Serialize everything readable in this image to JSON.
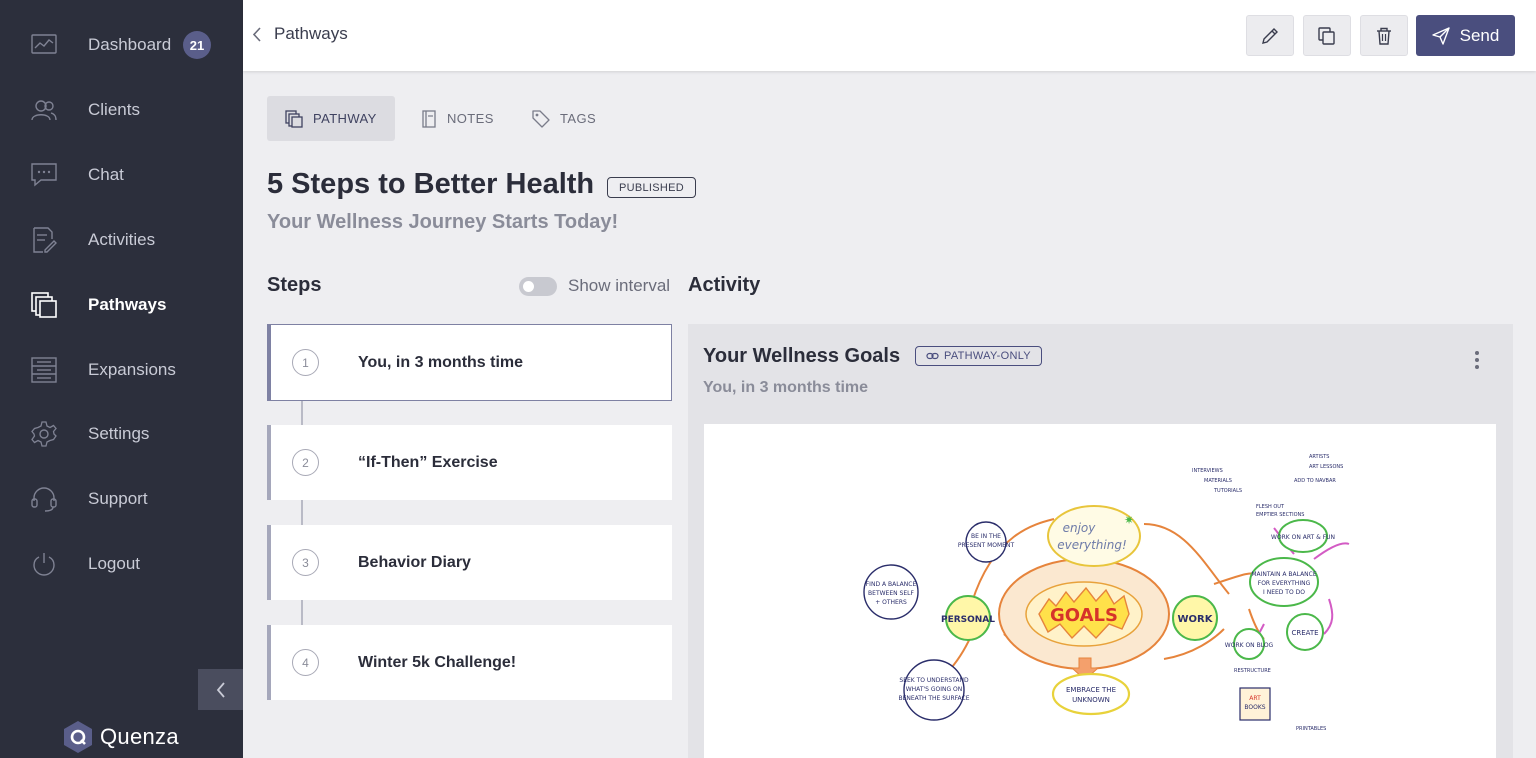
{
  "sidebar": {
    "items": [
      {
        "label": "Dashboard",
        "icon": "chart-icon",
        "badge": "21"
      },
      {
        "label": "Clients",
        "icon": "users-icon"
      },
      {
        "label": "Chat",
        "icon": "chat-icon"
      },
      {
        "label": "Activities",
        "icon": "edit-document-icon"
      },
      {
        "label": "Pathways",
        "icon": "copy-stack-icon",
        "active": true
      },
      {
        "label": "Expansions",
        "icon": "layers-icon"
      },
      {
        "label": "Settings",
        "icon": "gear-icon"
      },
      {
        "label": "Support",
        "icon": "headset-icon"
      },
      {
        "label": "Logout",
        "icon": "power-icon"
      }
    ],
    "logo_text": "Quenza"
  },
  "header": {
    "back_label": "Pathways",
    "send_label": "Send"
  },
  "tabs": [
    {
      "label": "PATHWAY",
      "icon": "copy-stack-icon",
      "active": true
    },
    {
      "label": "NOTES",
      "icon": "notebook-icon"
    },
    {
      "label": "TAGS",
      "icon": "tag-icon"
    }
  ],
  "pathway": {
    "title": "5 Steps to Better Health",
    "status": "PUBLISHED",
    "subtitle": "Your Wellness Journey Starts Today!"
  },
  "steps_section": {
    "heading": "Steps",
    "toggle_label": "Show interval",
    "toggle_on": false,
    "items": [
      {
        "number": "1",
        "title": "You, in 3 months time"
      },
      {
        "number": "2",
        "title": "“If-Then” Exercise"
      },
      {
        "number": "3",
        "title": "Behavior Diary"
      },
      {
        "number": "4",
        "title": "Winter 5k Challenge!"
      }
    ]
  },
  "activity": {
    "heading": "Activity",
    "title": "Your Wellness Goals",
    "badge": "PATHWAY-ONLY",
    "subtitle": "You, in 3 months time",
    "mindmap": {
      "center": "GOALS",
      "nodes": [
        "enjoy everything!",
        "PERSONAL",
        "WORK",
        "EMBRACE THE UNKNOWN",
        "CREATE",
        "MAINTAIN A BALANCE FOR EVERYTHING I NEED TO DO",
        "WORK ON ART & FUN",
        "WORK ON BLOG",
        "FIND A BALANCE BETWEEN SELF + OTHERS",
        "SEEK TO UNDERSTAND WHAT'S GOING ON BENEATH THE SURFACE",
        "BE IN THE PRESENT MOMENT",
        "ART BOOKS"
      ]
    }
  },
  "colors": {
    "sidebar_bg": "#2c2f3c",
    "accent": "#4a4e7e",
    "page_bg": "#eeeef1"
  }
}
